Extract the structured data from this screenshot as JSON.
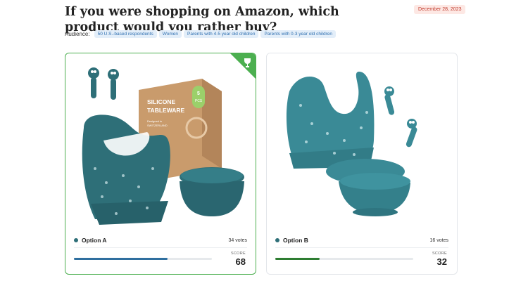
{
  "poll": {
    "title": "If you were shopping on Amazon, which product would you rather buy?",
    "date": "December 28, 2023"
  },
  "audience": {
    "label": "Audience:",
    "chips": [
      "50 U.S.-based respondents",
      "Women",
      "Parents with 4-5 year old children",
      "Parents with 0-3 year old children"
    ]
  },
  "options": [
    {
      "name": "Option A",
      "votes": "34 votes",
      "score_label": "SCORE",
      "score": "68",
      "score_fraction": 0.68,
      "winner": true,
      "box_text": [
        "SILICONE",
        "TABLEWARE",
        "5",
        "PCS",
        "Designed in",
        "SWITZERLAND"
      ]
    },
    {
      "name": "Option B",
      "votes": "16 votes",
      "score_label": "SCORE",
      "score": "32",
      "score_fraction": 0.32,
      "winner": false
    }
  ],
  "colors": {
    "winner_border": "#4caf50",
    "bar_a": "#2f6f9f",
    "bar_b": "#2e7d32",
    "product_teal": "#2e6f78",
    "product_teal_b": "#3a8a96",
    "badge_text": "#c0392b"
  },
  "icons": {
    "trophy": "trophy-icon"
  }
}
